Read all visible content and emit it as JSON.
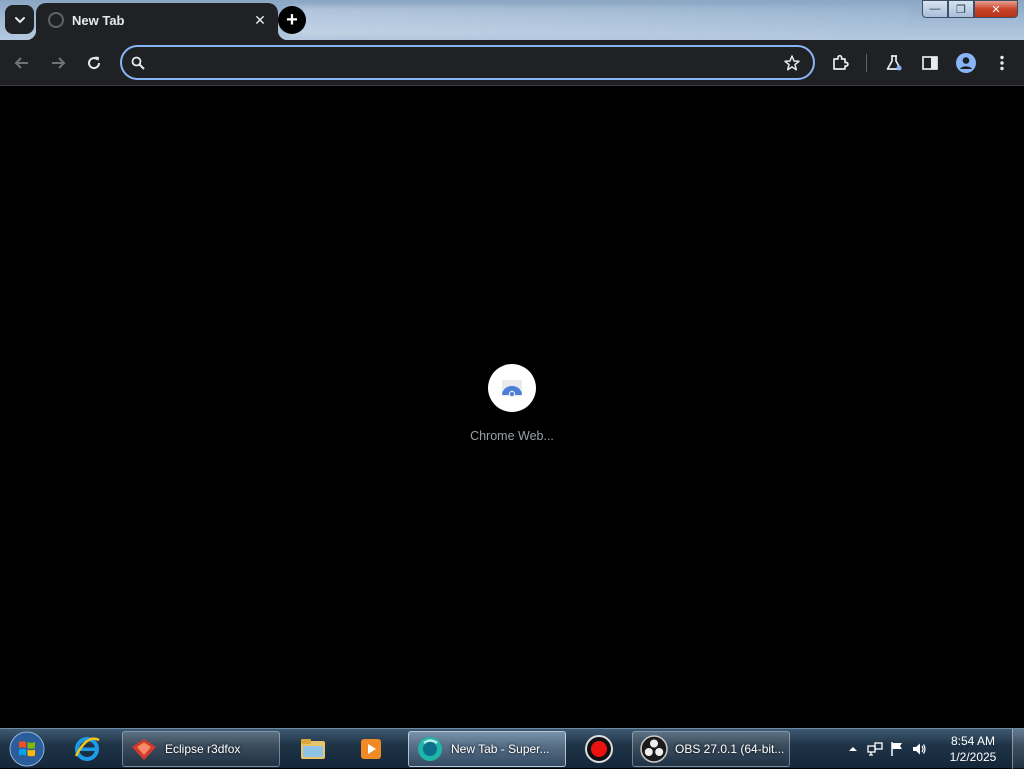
{
  "browser": {
    "tab_title": "New Tab",
    "new_tab_symbol": "+",
    "close_tab_symbol": "✕"
  },
  "omnibox": {
    "value": "",
    "placeholder": ""
  },
  "window_controls": {
    "minimize": "—",
    "maximize": "❐",
    "close": "✕"
  },
  "new_tab_page": {
    "shortcuts": [
      {
        "label": "Chrome Web..."
      }
    ]
  },
  "taskbar": {
    "items": [
      {
        "label": "Eclipse r3dfox",
        "icon": "firefox-fork-icon"
      },
      {
        "label": "New Tab - Super...",
        "icon": "chrome-fork-icon"
      },
      {
        "label": "OBS 27.0.1 (64-bit...",
        "icon": "obs-icon"
      }
    ],
    "clock": {
      "time": "8:54 AM",
      "date": "1/2/2025"
    }
  },
  "colors": {
    "accent": "#8ab4f8",
    "toolbar_bg": "#202124",
    "content_bg": "#000000"
  }
}
